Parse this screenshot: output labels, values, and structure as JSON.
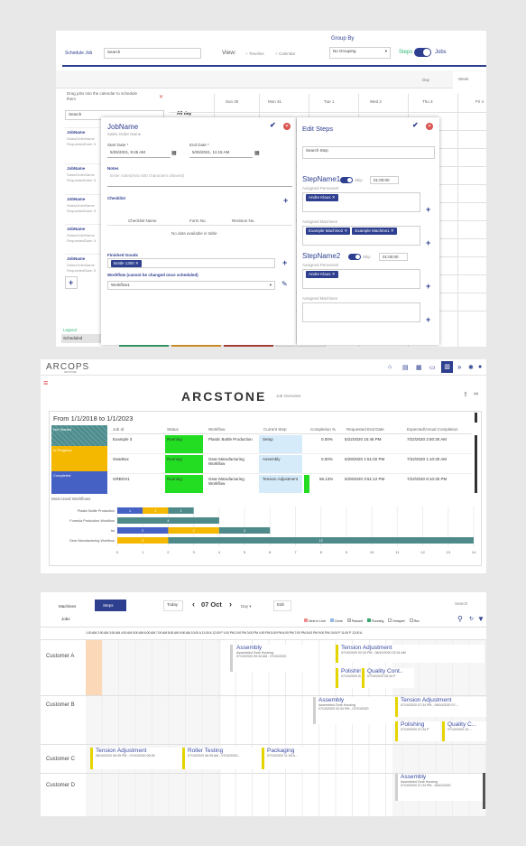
{
  "p1": {
    "schedule_job": "Schedule Job",
    "search_value": "Search",
    "view_label": "View:",
    "view_opts": [
      "Timeline",
      "Calendar"
    ],
    "group_by": "Group By",
    "grouping": "No Grouping",
    "steps": "Steps",
    "jobs": "Jobs",
    "day": "Day",
    "week": "Week",
    "all_day": "All day",
    "days": [
      "Sun 30",
      "Mon 31",
      "Tue 1",
      "Wed 2",
      "Thu 3",
      "Fri 4"
    ],
    "drag_hint": "Drag jobs into the calendar to schedule them",
    "search_ph": "Search",
    "jobs_list": [
      {
        "name": "JobName",
        "l1": "SalesOrderName",
        "l2": "RequestedDate: 5"
      },
      {
        "name": "JobName",
        "l1": "SalesOrderName",
        "l2": "RequestedDate: 5"
      },
      {
        "name": "JobName",
        "l1": "SalesOrderName",
        "l2": "RequestedDate: 5"
      },
      {
        "name": "JobName",
        "l1": "SalesOrderName",
        "l2": "RequestedDate: 5"
      },
      {
        "name": "JobName",
        "l1": "SalesOrderName",
        "l2": "RequestedDate: 5"
      }
    ],
    "legend": "Legend",
    "scheduled": "Scheduled",
    "job": {
      "title": "JobName",
      "sub": "Sales Order Name",
      "start_label": "Start Date *",
      "start": "5/26/2021, 9:45 AM",
      "end_label": "End Date *",
      "end": "5/26/2021, 11:15 AM",
      "notes": "Notes",
      "notes_ph": "Enter notes(max 500 characters allowed)",
      "checklist": "Checklist",
      "cols": [
        "Checklist Name",
        "Form No.",
        "Revision No."
      ],
      "empty": "No data available in table",
      "finished": "Finished Goods",
      "good": "Bottle 1300",
      "workflow_label": "Workflow (cannot be changed once scheduled)",
      "workflow": "Workflow1"
    },
    "steps_edit": {
      "title": "Edit Steps",
      "search": "Search Step",
      "skip": "Skip",
      "s1": {
        "name": "StepName1",
        "time": "01:00:00",
        "personnel_label": "Assigned Personnel",
        "personnel": [
          "Andre Klaus"
        ],
        "machines_label": "Assigned Machines",
        "machines": [
          "Example Machine2",
          "Example Machine1"
        ]
      },
      "s2": {
        "name": "StepName2",
        "time": "01:00:00",
        "personnel_label": "Assigned Personnel",
        "personnel": [
          "Andre Klaus"
        ],
        "machines_label": "Assigned Machines"
      }
    }
  },
  "p2": {
    "logo": "ARCOPS",
    "logo_sub": "ARCSTONE",
    "brand": "ARCSTONE",
    "page": "Job Overview",
    "range": "From 1/1/2018 to 1/1/2023",
    "cols": [
      "Job Id",
      "Status",
      "Workflow",
      "Current Step",
      "Completion %",
      "Requested End Date",
      "Expected/Actual Completion"
    ],
    "rows": [
      {
        "id": "Example 3",
        "status": "Running",
        "wf": "Plastic Bottle Production",
        "step": "Setup",
        "pct": "0.00%",
        "req": "5/22/2020 10:46 PM",
        "exp": "7/22/2020 2:50:30 AM"
      },
      {
        "id": "GearBox",
        "status": "Running",
        "wf": "Gear Manufacturing Workflow",
        "step": "Assembly",
        "pct": "0.00%",
        "req": "5/29/2020 1:51:02 PM",
        "exp": "7/22/2020 1:10:30 AM"
      },
      {
        "id": "GRBOX1",
        "status": "Running",
        "wf": "Gear Manufacturing Workflow",
        "step": "Tension Adjustment",
        "pct": "56.13%",
        "req": "5/29/2020 3:51:12 PM",
        "exp": "7/22/2020 8:10:30 PM"
      }
    ],
    "left_labels": [
      "Not Started",
      "In Progress",
      "Completed"
    ],
    "wf_title": "Most Used Workflows",
    "chart_data": {
      "type": "bar",
      "orientation": "horizontal",
      "stacked": true,
      "categories": [
        "Plastic Bottle Production",
        "Formula Production Workflow",
        "tst",
        "Gear Manufacturing Workflow"
      ],
      "series": [
        {
          "color": "#4561c4",
          "values": [
            1,
            0,
            2,
            0
          ]
        },
        {
          "color": "#f5b800",
          "values": [
            1,
            0,
            2,
            2
          ]
        },
        {
          "color": "#4f8a8b",
          "values": [
            1,
            4,
            2,
            12
          ]
        }
      ],
      "xticks": [
        0,
        1,
        2,
        3,
        4,
        5,
        6,
        7,
        8,
        9,
        10,
        11,
        12,
        13,
        14
      ],
      "xlim": [
        0,
        14
      ]
    }
  },
  "p3": {
    "machines": "Machines",
    "steps": "Steps",
    "today": "Today",
    "date": "07 Oct",
    "day": "Day",
    "edit": "Edit",
    "jobs": "Jobs",
    "search": "Search",
    "legend": [
      {
        "label": "Next In Line",
        "color": "#f28b8b"
      },
      {
        "label": "Done",
        "color": "#8fb8e8"
      },
      {
        "label": "Paused",
        "color": "#dddddd"
      },
      {
        "label": "Running",
        "color": "#3aa76d"
      },
      {
        "label": "Delayed",
        "color": "#ffffff"
      },
      {
        "label": "Rec",
        "color": "#ffffff"
      }
    ],
    "hours": "1:00 AM 2:00 AM 3:00 AM 4:00 AM 5:00 AM 6:00 AM 7:00 AM 8:00 AM 9:00 AM 10:00 A 11:00 A 12:00 P 1:00 PM 2:00 PM 3:00 PM 4:00 PM 5:00 PM 6:00 PM 7:00 PM 8:00 PM 9:00 PM 10:00 P 11:00 P 12:00 A",
    "customers": [
      "Customer A",
      "Customer B",
      "Customer C",
      "Customer D"
    ],
    "events": {
      "a1": {
        "t": "Assembly",
        "s": "Assembled Gear Housing",
        "d": "07/10/2020 09:34 AM - 07/10/2020"
      },
      "a2": {
        "t": "Tension Adjustment",
        "d": "07/10/2020 02:34 PM - 08/10/2020 02:34 AM"
      },
      "a3": {
        "t": "Polishing",
        "d": "07/10/2020 02:34 P"
      },
      "a4": {
        "t": "Quality Cont..",
        "d": "07/10/2020 05:34 P"
      },
      "b1": {
        "t": "Assembly",
        "s": "Assembled Gear Housing",
        "d": "07/10/2020 02:34 PM - 07/10/2020"
      },
      "b2": {
        "t": "Tension Adjustment",
        "d": "07/10/2020 07:34 PM - 08/10/2020 07:..."
      },
      "b3": {
        "t": "Polishing",
        "d": "07/10/2020 07:34 P"
      },
      "b4": {
        "t": "Quality C...",
        "d": "07/10/2020 10:..."
      },
      "c1": {
        "t": "Tension Adjustment",
        "d": "06/10/2020 06:35 PM - 07/10/2020 06:35"
      },
      "c2": {
        "t": "Roller Testing",
        "d": "07/10/2020 06:35 AM - 07/10/2020..."
      },
      "c3": {
        "t": "Packaging",
        "d": "07/10/2020 11:35 A..."
      },
      "d1": {
        "t": "Assembly",
        "s": "Assembled Gear Housing",
        "d": "07/10/2020 07:34 PM - 08/10/2020"
      }
    }
  }
}
